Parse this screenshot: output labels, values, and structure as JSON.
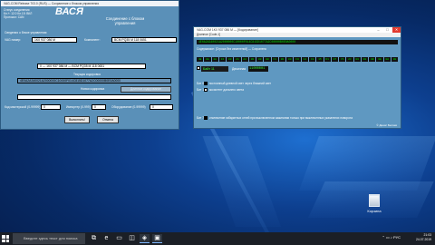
{
  "vasya": {
    "title": "VAG-COM Release 703.0 (RUS) — Сохранение с блоком управления",
    "left_labels": [
      "Статус соединения",
      "Кл.+: 12.0 Кл.15: ВКЛ",
      "Протокол: CAN"
    ],
    "logo": "ВАСЯ",
    "subtitle": "Соединение с блоком управления",
    "section_label": "Сведения о блоке управления",
    "vag_label": "VAG номер:",
    "vag_value": "1K0 937 086 M",
    "component_label": "Компонент:",
    "component_value": "BCM PQ35 M 118 0651",
    "coding_value": "0 — 1K0 937 086 M — BCM PQ35 M 118 0651",
    "current_coding_label": "Текущая кодировка",
    "current_coding": "4E0A2A340021A2000000C10000F014C815D1077A2C00000B0E0A0000",
    "new_coding_label": "Новая кодировка",
    "long_coding_btn": "Длинное кодирование",
    "workshop_label": "Код мастерской (0-99999)",
    "importer_label": "Импортер (0-999)",
    "equipment_label": "Оборудование (0-99999)",
    "workshop_value": "0",
    "importer_value": "0",
    "equipment_value": "0",
    "execute_btn": "Выполнить!",
    "cancel_btn": "Отмена"
  },
  "coding": {
    "title": "VAG-COM 1K0 937 086 M — [Кодирование]",
    "menu": "Длинное   [Code-1]",
    "hex": "4E0A2A340021A2000000C10000F014C815D1077A2C00000B0E0A0000",
    "ok_line": "Содержимое: [Строка без изменений] — Сохранено",
    "bytes": [
      "4E",
      "0A",
      "2A",
      "34",
      "00",
      "21",
      "A2",
      "00",
      "00",
      "00",
      "C1",
      "00",
      "00",
      "F0",
      "14",
      "C8",
      "15",
      "D1",
      "07",
      "7A",
      "2C",
      "00",
      "00",
      "0B",
      "0E",
      "0A",
      "00"
    ],
    "byte_label": "Байт 11",
    "binary_label": "Двоичная",
    "binary_value": "11000001",
    "bits": [
      {
        "label": "Бит 0",
        "text": "постоянный дневной свет через ближний свет",
        "checked": true
      },
      {
        "label": "Бит 1",
        "text": "ассистент дальнего света",
        "checked": false
      },
      {
        "label": "Бит 7",
        "text": "отключение габаритных огней при выключенном зажигании только при выключенных указателях поворота",
        "checked": true
      }
    ],
    "footer": "© Денис Беляев"
  },
  "desktop": {
    "recycle_label": "Корзина"
  },
  "taskbar": {
    "search_placeholder": "Введите здесь текст для поиска",
    "lang": "РУС",
    "time": "21:03",
    "date": "24.07.2019"
  }
}
